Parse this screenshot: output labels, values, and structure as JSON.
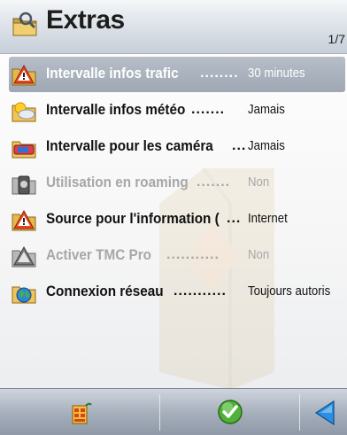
{
  "header": {
    "title": "Extras",
    "page_indicator": "1/7",
    "icon": "extras-folder-icon"
  },
  "settings": [
    {
      "label": "Intervalle infos trafic",
      "dots": "........",
      "value": "30 minutes",
      "icon": "traffic-warning-icon",
      "selected": true,
      "enabled": true
    },
    {
      "label": "Intervalle infos météo",
      "dots": ".......",
      "value": "Jamais",
      "icon": "weather-icon",
      "selected": false,
      "enabled": true
    },
    {
      "label": "Intervalle pour les caméra",
      "dots": "...",
      "value": "Jamais",
      "icon": "camera-icon",
      "selected": false,
      "enabled": true
    },
    {
      "label": "Utilisation en roaming",
      "dots": ".......",
      "value": "Non",
      "icon": "roaming-phone-icon",
      "selected": false,
      "enabled": false
    },
    {
      "label": "Source pour l'information (",
      "dots": "...",
      "value": "Internet",
      "icon": "info-source-warning-icon",
      "selected": false,
      "enabled": true
    },
    {
      "label": "Activer TMC Pro",
      "dots": "...........",
      "value": "Non",
      "icon": "tmc-pro-icon",
      "selected": false,
      "enabled": false
    },
    {
      "label": "Connexion réseau",
      "dots": "...........",
      "value": "Toujours autoris",
      "icon": "network-globe-icon",
      "selected": false,
      "enabled": true
    }
  ],
  "toolbar": {
    "buttons": [
      {
        "icon": "options-menu-icon"
      },
      {
        "icon": "confirm-check-icon"
      },
      {
        "icon": "back-arrow-icon"
      }
    ]
  },
  "colors": {
    "selection": "#a7afba",
    "toolbar": "#a7b0bd",
    "disabled_text": "#a7a7a7",
    "confirm_green": "#4fb03a",
    "back_blue": "#2a8fe0"
  }
}
